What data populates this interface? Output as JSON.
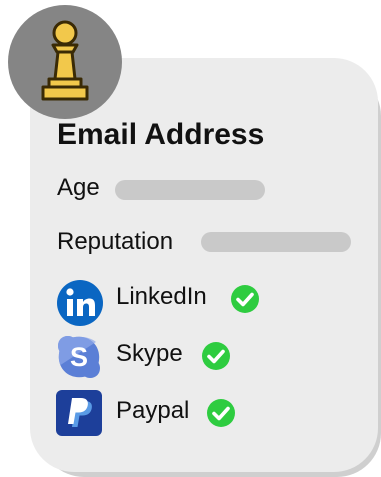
{
  "profile": {
    "title": "Email Address",
    "age_label": "Age",
    "reputation_label": "Reputation"
  },
  "accounts": [
    {
      "name": "LinkedIn",
      "icon": "linkedin-icon",
      "verified": true,
      "color": "#0a66c2"
    },
    {
      "name": "Skype",
      "icon": "skype-icon",
      "verified": true,
      "color": "#5b7fd6"
    },
    {
      "name": "Paypal",
      "icon": "paypal-icon",
      "verified": true,
      "color": "#1d3f9a"
    }
  ],
  "colors": {
    "card": "#ececec",
    "avatar_bg": "#858585",
    "pawn": "#f2c84b",
    "check": "#2ecc40",
    "placeholder_bar": "#c9c9c9"
  }
}
